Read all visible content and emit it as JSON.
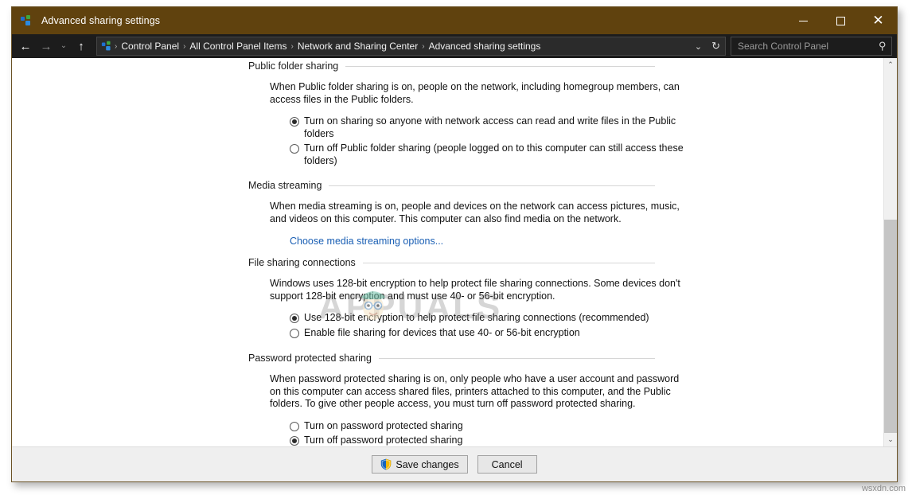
{
  "window": {
    "title": "Advanced sharing settings",
    "icon": "network-sharing-icon",
    "minimize_label": "Minimize",
    "maximize_label": "Maximize",
    "close_label": "Close"
  },
  "addressbar": {
    "back_label": "←",
    "forward_label": "→",
    "history_label": "⌄",
    "up_label": "↑",
    "breadcrumbs": [
      {
        "label": "Control Panel"
      },
      {
        "label": "All Control Panel Items"
      },
      {
        "label": "Network and Sharing Center"
      },
      {
        "label": "Advanced sharing settings"
      }
    ],
    "separator": "›",
    "dropdown_label": "⌄",
    "refresh_label": "↻",
    "search": {
      "placeholder": "Search Control Panel",
      "value": "",
      "icon": "search-icon"
    }
  },
  "sections": [
    {
      "id": "public-folder-sharing",
      "heading": "Public folder sharing",
      "paragraph": "When Public folder sharing is on, people on the network, including homegroup members, can access files in the Public folders.",
      "options": [
        {
          "label": "Turn on sharing so anyone with network access can read and write files in the Public folders",
          "selected": true
        },
        {
          "label": "Turn off Public folder sharing (people logged on to this computer can still access these folders)",
          "selected": false
        }
      ]
    },
    {
      "id": "media-streaming",
      "heading": "Media streaming",
      "paragraph": "When media streaming is on, people and devices on the network can access pictures, music, and videos on this computer. This computer can also find media on the network.",
      "link": "Choose media streaming options...",
      "options": []
    },
    {
      "id": "file-sharing-connections",
      "heading": "File sharing connections",
      "paragraph": "Windows uses 128-bit encryption to help protect file sharing connections. Some devices don't support 128-bit encryption and must use 40- or 56-bit encryption.",
      "options": [
        {
          "label": "Use 128-bit encryption to help protect file sharing connections (recommended)",
          "selected": true
        },
        {
          "label": "Enable file sharing for devices that use 40- or 56-bit encryption",
          "selected": false
        }
      ]
    },
    {
      "id": "password-protected-sharing",
      "heading": "Password protected sharing",
      "paragraph": "When password protected sharing is on, only people who have a user account and password on this computer can access shared files, printers attached to this computer, and the Public folders. To give other people access, you must turn off password protected sharing.",
      "options": [
        {
          "label": "Turn on password protected sharing",
          "selected": false
        },
        {
          "label": "Turn off password protected sharing",
          "selected": true
        }
      ]
    }
  ],
  "scrollbar": {
    "up_label": "⌃",
    "down_label": "⌄"
  },
  "footer": {
    "save_label": "Save changes",
    "save_icon": "uac-shield-icon",
    "cancel_label": "Cancel"
  },
  "watermarks": {
    "appuals": "APPUALS",
    "site": "wsxdn.com"
  },
  "colors": {
    "titlebar": "#60420e",
    "addressbar": "#1c1c1c",
    "link": "#1a5fb4",
    "border": "#6b5327",
    "footer": "#efefef"
  }
}
